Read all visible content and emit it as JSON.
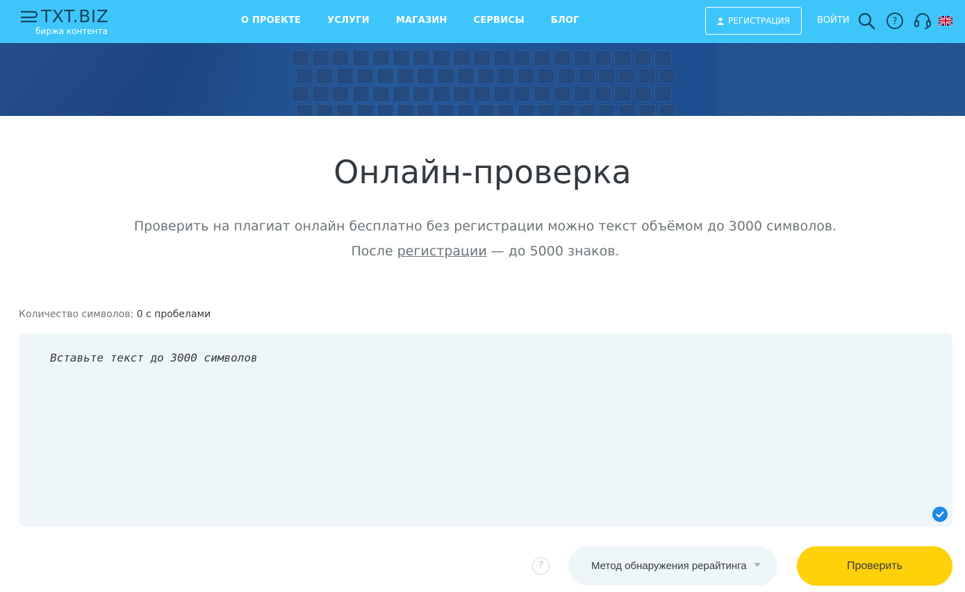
{
  "header": {
    "logo_text": "TXT.BIZ",
    "logo_subtitle": "биржа контента",
    "nav": [
      {
        "label": "О ПРОЕКТЕ"
      },
      {
        "label": "УСЛУГИ"
      },
      {
        "label": "МАГАЗИН"
      },
      {
        "label": "СЕРВИСЫ"
      },
      {
        "label": "БЛОГ"
      }
    ],
    "register_label": "РЕГИСТРАЦИЯ",
    "login_label": "ВОЙТИ",
    "icons": [
      "search-icon",
      "help-icon",
      "support-headset-icon",
      "uk-flag-icon"
    ],
    "accent_color": "#3ec6fb"
  },
  "main": {
    "title": "Онлайн-проверка",
    "desc_line1": "Проверить на плагиат онлайн бесплатно без регистрации можно текст объёмом до 3000 символов.",
    "desc_line2_before": "После ",
    "desc_line2_link": "регистрации",
    "desc_line2_after": " — до 5000 знаков.",
    "count_label": "Количество символов: ",
    "count_value": "0 с пробелами",
    "textarea_placeholder": "Вставьте текст до 3000 символов",
    "textarea_value": "",
    "help_label": "?",
    "method_label": "Метод обнаружения рерайтинга",
    "submit_label": "Проверить",
    "submit_color": "#ffd10a"
  }
}
